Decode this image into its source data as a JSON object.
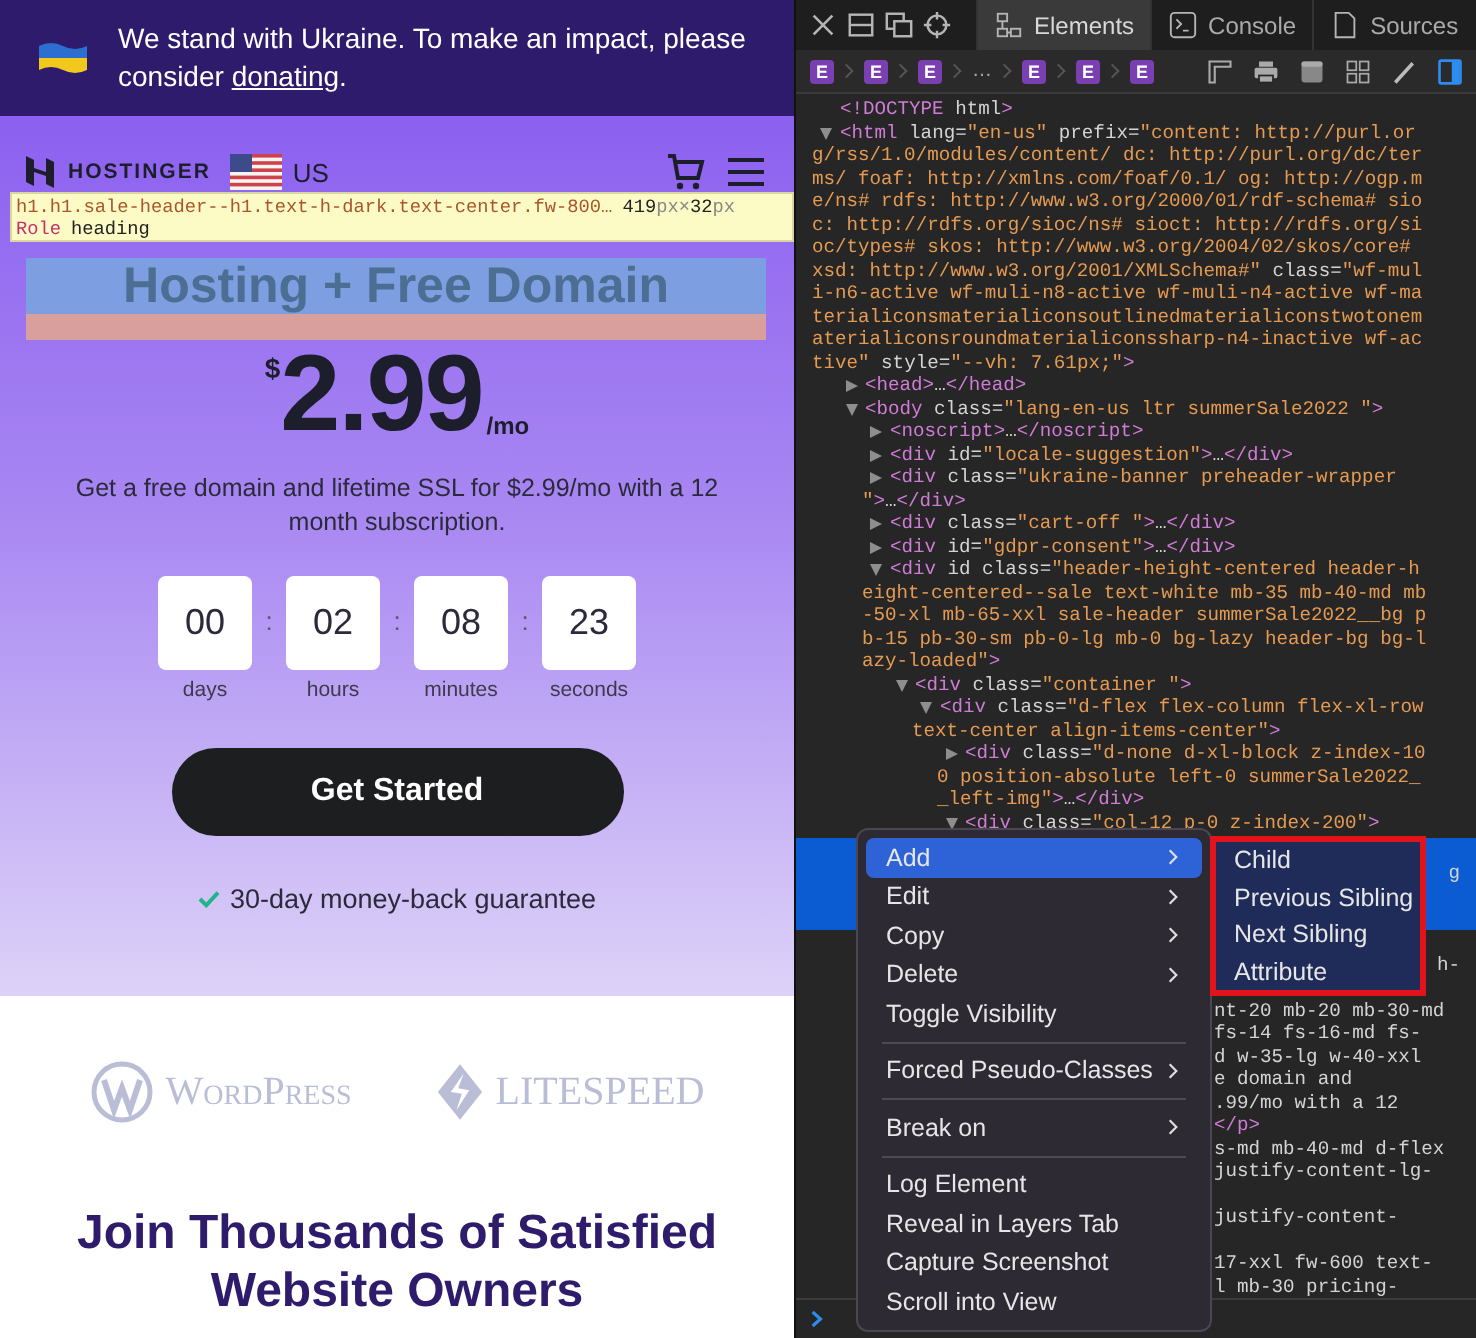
{
  "page": {
    "banner": {
      "text_before": "We stand with Ukraine. To make an impact, please consider ",
      "link": "donating",
      "text_after": "."
    },
    "nav": {
      "brand": "HOSTINGER",
      "region": "US"
    },
    "inspector_tooltip": {
      "selector": "h1.h1.sale-header--h1.text-h-dark.text-center.fw-800…",
      "size": [
        {
          "value": "419",
          "unit": "px"
        },
        {
          "value": "32",
          "unit": "px"
        }
      ],
      "size_separator": "×",
      "role_label": "Role",
      "role": "heading"
    },
    "hero": {
      "title": "Hosting + Free Domain",
      "highlighted": true,
      "currency": "$",
      "price": "2.99",
      "period": "/mo",
      "description": "Get a free domain and lifetime SSL for $2.99/mo with a 12 month subscription.",
      "countdown": {
        "separator": ":",
        "units": [
          {
            "value": "00",
            "label": "days"
          },
          {
            "value": "02",
            "label": "hours"
          },
          {
            "value": "08",
            "label": "minutes"
          },
          {
            "value": "23",
            "label": "seconds"
          }
        ]
      },
      "cta": "Get Started",
      "guarantee": "30-day money-back guarantee"
    },
    "partners": [
      {
        "kind": "wordpress",
        "name": "WordPress"
      },
      {
        "kind": "litespeed",
        "name": "LITESPEED"
      }
    ],
    "section_title": "Join Thousands of Satisfied Website Owners"
  },
  "devtools": {
    "tabs": [
      {
        "kind": "elements",
        "label": "Elements",
        "selected": true
      },
      {
        "kind": "console",
        "label": "Console",
        "selected": false
      },
      {
        "kind": "sources",
        "label": "Sources",
        "selected": false
      }
    ],
    "breadcrumbs": [
      {
        "kind": "element",
        "badge": "E"
      },
      {
        "kind": "element",
        "badge": "E"
      },
      {
        "kind": "element",
        "badge": "E"
      },
      {
        "kind": "ellipsis",
        "text": "…"
      },
      {
        "kind": "element",
        "badge": "E"
      },
      {
        "kind": "element",
        "badge": "E"
      },
      {
        "kind": "element",
        "badge": "E"
      }
    ],
    "tree": [
      {
        "text": "<!DOCTYPE html>"
      },
      {
        "text": "<html lang=\"en-us\" prefix=\"content: http://purl.org/rss/1.0/modules/content/ dc: http://purl.org/dc/terms/ foaf: http://xmlns.com/foaf/0.1/ og: http://ogp.me/ns# rdfs: http://www.w3.org/2000/01/rdf-schema# sioc: http://rdfs.org/sioc/ns# sioct: http://rdfs.org/sioc/types# skos: http://www.w3.org/2004/02/skos/core# xsd: http://www.w3.org/2001/XMLSchema#\" class=\"wf-muli-n6-active wf-muli-n8-active wf-muli-n4-active wf-materialiconsmaterialiconsoutlinedmaterialiconstwotonematerialiconsroundmaterialiconssharp-n4-inactive wf-active\" style=\"--vh: 7.61px;\">",
        "expanded": true,
        "children": [
          {
            "text": "<head>…</head>",
            "expanded": false
          },
          {
            "text": "<body class=\"lang-en-us ltr summerSale2022 \">",
            "expanded": true,
            "children": [
              {
                "text": "<noscript>…</noscript>",
                "expanded": false
              },
              {
                "text": "<div id=\"locale-suggestion\">…</div>",
                "expanded": false
              },
              {
                "text": "<div class=\"ukraine-banner preheader-wrapper \">…</div>",
                "expanded": false
              },
              {
                "text": "<div class=\"cart-off \">…</div>",
                "expanded": false
              },
              {
                "text": "<div id=\"gdpr-consent\">…</div>",
                "expanded": false
              },
              {
                "text": "<div id class=\"header-height-centered header-height-centered--sale text-white mb-35 mb-40-md mb-50-xl mb-65-xxl sale-header summerSale2022__bg pb-15 pb-30-sm pb-0-lg mb-0 bg-lazy header-bg bg-lazy-loaded\">",
                "expanded": true,
                "children": [
                  {
                    "text": "<div class=\"container \">",
                    "expanded": true,
                    "children": [
                      {
                        "text": "<div class=\"d-flex flex-column flex-xl-row text-center align-items-center\">",
                        "expanded": true,
                        "children": [
                          {
                            "text": "<div class=\"d-none d-xl-block z-index-100 position-absolute left-0 summerSale2022__left-img\">…</div>",
                            "expanded": false
                          },
                          {
                            "text": "<div class=\"col-12 p-0 z-index-200\">",
                            "expanded": true
                          }
                        ]
                      }
                    ]
                  }
                ]
              }
            ]
          }
        ]
      }
    ],
    "covered_rows": [
      {
        "selected": true
      },
      {
        "selected": true,
        "text": "g",
        "flush_right": true
      },
      {
        "selected": true
      },
      {
        "selected": true
      },
      {
        "selected": false
      },
      {
        "selected": false,
        "text": "h-",
        "flush_right": true
      },
      {
        "selected": false
      },
      {
        "selected": false,
        "text": "nt-20 mb-20 mb-30-md"
      },
      {
        "selected": false,
        "text": "fs-14 fs-16-md fs-"
      },
      {
        "selected": false,
        "text": "d w-35-lg w-40-xxl"
      },
      {
        "selected": false,
        "text": "e domain and"
      },
      {
        "selected": false,
        "text": ".99/mo with a 12"
      },
      {
        "selected": false,
        "text": "</p>"
      },
      {
        "selected": false,
        "text": "s-md mb-40-md d-flex"
      },
      {
        "selected": false,
        "text": "justify-content-lg-"
      },
      {
        "selected": false
      },
      {
        "selected": false,
        "text": "justify-content-"
      },
      {
        "selected": false
      },
      {
        "selected": false,
        "text": "17-xxl fw-600 text-"
      },
      {
        "selected": false,
        "text": "l mb-30 pricing-"
      }
    ],
    "context_menu": {
      "items": [
        {
          "kind": "item",
          "label": "Add",
          "submenu": true,
          "selected": true
        },
        {
          "kind": "item",
          "label": "Edit",
          "submenu": true,
          "selected": false
        },
        {
          "kind": "item",
          "label": "Copy",
          "submenu": true,
          "selected": false
        },
        {
          "kind": "item",
          "label": "Delete",
          "submenu": true,
          "selected": false
        },
        {
          "kind": "item",
          "label": "Toggle Visibility",
          "submenu": false,
          "selected": false
        },
        {
          "kind": "separator"
        },
        {
          "kind": "item",
          "label": "Forced Pseudo-Classes",
          "submenu": true,
          "selected": false
        },
        {
          "kind": "separator"
        },
        {
          "kind": "item",
          "label": "Break on",
          "submenu": true,
          "selected": false
        },
        {
          "kind": "separator"
        },
        {
          "kind": "item",
          "label": "Log Element",
          "submenu": false,
          "selected": false
        },
        {
          "kind": "item",
          "label": "Reveal in Layers Tab",
          "submenu": false,
          "selected": false
        },
        {
          "kind": "item",
          "label": "Capture Screenshot",
          "submenu": false,
          "selected": false
        },
        {
          "kind": "item",
          "label": "Scroll into View",
          "submenu": false,
          "selected": false
        }
      ],
      "submenu": {
        "outlined": true,
        "items": [
          "Child",
          "Previous Sibling",
          "Next Sibling",
          "Attribute"
        ]
      }
    }
  }
}
